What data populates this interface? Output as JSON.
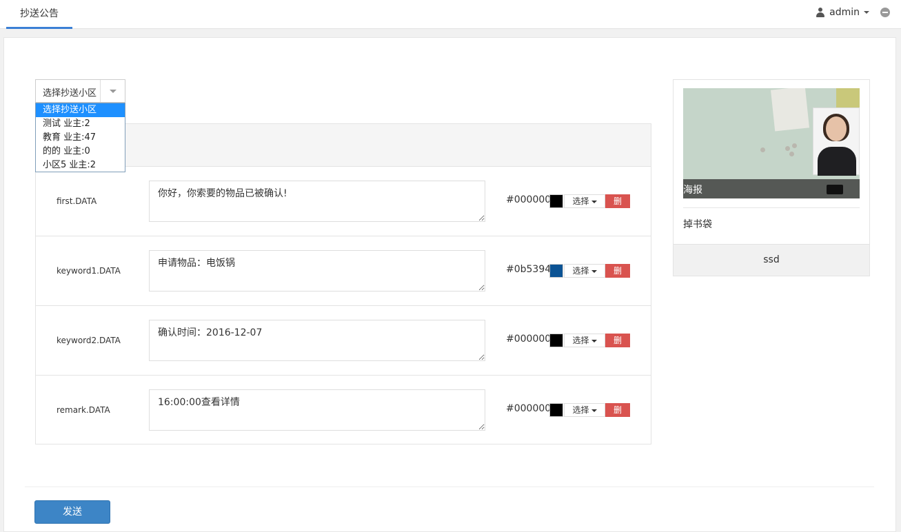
{
  "header": {
    "tab_label": "抄送公告",
    "user_name": "admin"
  },
  "community_select": {
    "value": "选择抄送小区",
    "options": [
      "选择抄送小区",
      "测试 业主:2",
      "教育 业主:47",
      "的的 业主:0",
      "小区5 业主:2"
    ],
    "selected_index": 0
  },
  "fields": [
    {
      "key": "first.DATA",
      "value": "你好，你索要的物品已被确认!",
      "color": "#000000",
      "swatch": "#000000",
      "pick_label": "选择",
      "delete_label": "删"
    },
    {
      "key": "keyword1.DATA",
      "value": "申请物品：电饭锅",
      "color": "#0b5394",
      "swatch": "#0b5394",
      "pick_label": "选择",
      "delete_label": "删"
    },
    {
      "key": "keyword2.DATA",
      "value": "确认时间：2016-12-07",
      "color": "#000000",
      "swatch": "#000000",
      "pick_label": "选择",
      "delete_label": "删"
    },
    {
      "key": "remark.DATA",
      "value": "16:00:00查看详情",
      "color": "#000000",
      "swatch": "#000000",
      "pick_label": "选择",
      "delete_label": "删"
    }
  ],
  "card": {
    "image_caption": "海报",
    "title": "掉书袋",
    "footer": "ssd"
  },
  "actions": {
    "send_label": "发送"
  },
  "colors": {
    "accent": "#3a7fd5",
    "primary_button": "#3d85c6",
    "danger_button": "#d9534f",
    "option_highlight": "#1e90ff"
  }
}
